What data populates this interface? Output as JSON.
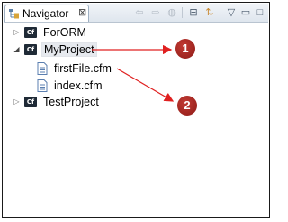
{
  "view": {
    "tab_label": "Navigator",
    "tab_close": "⊠",
    "toolbar": {
      "back": "⇦",
      "forward": "⇨",
      "link": "◍",
      "collapse": "⊟",
      "sync": "⇅",
      "menu": "▽",
      "minimize": "▭",
      "maximize": "□"
    }
  },
  "tree": {
    "items": [
      {
        "label": "ForORM",
        "type": "project",
        "expanded": false,
        "icon_text": "Cf"
      },
      {
        "label": "MyProject",
        "type": "project",
        "expanded": true,
        "selected": true,
        "icon_text": "Cf"
      },
      {
        "label": "firstFile.cfm",
        "type": "file"
      },
      {
        "label": "index.cfm",
        "type": "file"
      },
      {
        "label": "TestProject",
        "type": "project",
        "expanded": false,
        "icon_text": "Cf"
      }
    ],
    "twisty_collapsed": "▷",
    "twisty_expanded": "◢"
  },
  "callouts": [
    "1",
    "2"
  ],
  "colors": {
    "callout": "#a4221d",
    "arrow": "#e02020",
    "selection": "#e6e9ee"
  }
}
